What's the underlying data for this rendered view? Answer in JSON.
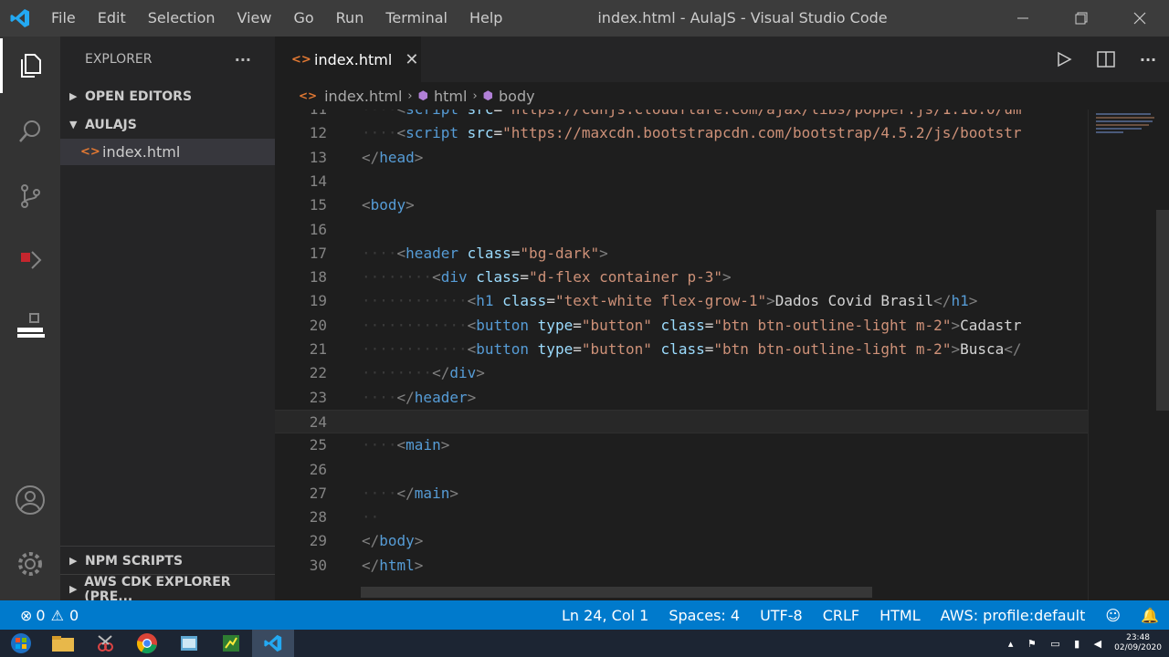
{
  "window": {
    "title": "index.html - AulaJS - Visual Studio Code"
  },
  "menu": [
    "File",
    "Edit",
    "Selection",
    "View",
    "Go",
    "Run",
    "Terminal",
    "Help"
  ],
  "sidebar": {
    "header": "EXPLORER",
    "more": "···",
    "open_editors": "OPEN EDITORS",
    "project": "AULAJS",
    "file": "index.html",
    "npm_scripts": "NPM SCRIPTS",
    "aws": "AWS CDK EXPLORER (PRE..."
  },
  "tab": {
    "label": "index.html",
    "close": "✕"
  },
  "breadcrumb": {
    "file": "index.html",
    "html": "html",
    "body": "body"
  },
  "code": {
    "lines": [
      {
        "n": "11",
        "tokens": [
          [
            "w",
            "····"
          ],
          [
            "p",
            "<"
          ],
          [
            "t",
            "script"
          ],
          [
            "x2",
            " "
          ],
          [
            "a",
            "src"
          ],
          [
            "x2",
            "="
          ],
          [
            "s",
            "\"https://cdnjs.cloudflare.com/ajax/libs/popper.js/1.16.0/um"
          ]
        ]
      },
      {
        "n": "12",
        "tokens": [
          [
            "w",
            "····"
          ],
          [
            "p",
            "<"
          ],
          [
            "t",
            "script"
          ],
          [
            "x2",
            " "
          ],
          [
            "a",
            "src"
          ],
          [
            "x2",
            "="
          ],
          [
            "s",
            "\"https://maxcdn.bootstrapcdn.com/bootstrap/4.5.2/js/bootstr"
          ]
        ]
      },
      {
        "n": "13",
        "tokens": [
          [
            "p",
            "</"
          ],
          [
            "t",
            "head"
          ],
          [
            "p",
            ">"
          ]
        ]
      },
      {
        "n": "14",
        "tokens": []
      },
      {
        "n": "15",
        "tokens": [
          [
            "p",
            "<"
          ],
          [
            "t",
            "body"
          ],
          [
            "p",
            ">"
          ]
        ]
      },
      {
        "n": "16",
        "tokens": []
      },
      {
        "n": "17",
        "tokens": [
          [
            "w",
            "····"
          ],
          [
            "p",
            "<"
          ],
          [
            "t",
            "header"
          ],
          [
            "x2",
            " "
          ],
          [
            "a",
            "class"
          ],
          [
            "x2",
            "="
          ],
          [
            "s",
            "\"bg-dark\""
          ],
          [
            "p",
            ">"
          ]
        ]
      },
      {
        "n": "18",
        "tokens": [
          [
            "w",
            "········"
          ],
          [
            "p",
            "<"
          ],
          [
            "t",
            "div"
          ],
          [
            "x2",
            " "
          ],
          [
            "a",
            "class"
          ],
          [
            "x2",
            "="
          ],
          [
            "s",
            "\"d-flex container p-3\""
          ],
          [
            "p",
            ">"
          ]
        ]
      },
      {
        "n": "19",
        "tokens": [
          [
            "w",
            "············"
          ],
          [
            "p",
            "<"
          ],
          [
            "t",
            "h1"
          ],
          [
            "x2",
            " "
          ],
          [
            "a",
            "class"
          ],
          [
            "x2",
            "="
          ],
          [
            "s",
            "\"text-white flex-grow-1\""
          ],
          [
            "p",
            ">"
          ],
          [
            "x2",
            "Dados Covid Brasil"
          ],
          [
            "p",
            "</"
          ],
          [
            "t",
            "h1"
          ],
          [
            "p",
            ">"
          ]
        ]
      },
      {
        "n": "20",
        "tokens": [
          [
            "w",
            "············"
          ],
          [
            "p",
            "<"
          ],
          [
            "t",
            "button"
          ],
          [
            "x2",
            " "
          ],
          [
            "a",
            "type"
          ],
          [
            "x2",
            "="
          ],
          [
            "s",
            "\"button\""
          ],
          [
            "x2",
            " "
          ],
          [
            "a",
            "class"
          ],
          [
            "x2",
            "="
          ],
          [
            "s",
            "\"btn btn-outline-light m-2\""
          ],
          [
            "p",
            ">"
          ],
          [
            "x2",
            "Cadastr"
          ]
        ]
      },
      {
        "n": "21",
        "tokens": [
          [
            "w",
            "············"
          ],
          [
            "p",
            "<"
          ],
          [
            "t",
            "button"
          ],
          [
            "x2",
            " "
          ],
          [
            "a",
            "type"
          ],
          [
            "x2",
            "="
          ],
          [
            "s",
            "\"button\""
          ],
          [
            "x2",
            " "
          ],
          [
            "a",
            "class"
          ],
          [
            "x2",
            "="
          ],
          [
            "s",
            "\"btn btn-outline-light m-2\""
          ],
          [
            "p",
            ">"
          ],
          [
            "x2",
            "Busca"
          ],
          [
            "p",
            "</"
          ]
        ]
      },
      {
        "n": "22",
        "tokens": [
          [
            "w",
            "········"
          ],
          [
            "p",
            "</"
          ],
          [
            "t",
            "div"
          ],
          [
            "p",
            ">"
          ]
        ]
      },
      {
        "n": "23",
        "tokens": [
          [
            "w",
            "····"
          ],
          [
            "p",
            "</"
          ],
          [
            "t",
            "header"
          ],
          [
            "p",
            ">"
          ]
        ]
      },
      {
        "n": "24",
        "tokens": []
      },
      {
        "n": "25",
        "tokens": [
          [
            "w",
            "····"
          ],
          [
            "p",
            "<"
          ],
          [
            "t",
            "main"
          ],
          [
            "p",
            ">"
          ]
        ]
      },
      {
        "n": "26",
        "tokens": []
      },
      {
        "n": "27",
        "tokens": [
          [
            "w",
            "····"
          ],
          [
            "p",
            "</"
          ],
          [
            "t",
            "main"
          ],
          [
            "p",
            ">"
          ]
        ]
      },
      {
        "n": "28",
        "tokens": [
          [
            "w",
            "··"
          ]
        ]
      },
      {
        "n": "29",
        "tokens": [
          [
            "p",
            "</"
          ],
          [
            "t",
            "body"
          ],
          [
            "p",
            ">"
          ]
        ]
      },
      {
        "n": "30",
        "tokens": [
          [
            "p",
            "</"
          ],
          [
            "t",
            "html"
          ],
          [
            "p",
            ">"
          ]
        ]
      }
    ]
  },
  "status": {
    "errors": "0",
    "warnings": "0",
    "position": "Ln 24, Col 1",
    "spaces": "Spaces: 4",
    "encoding": "UTF-8",
    "eol": "CRLF",
    "language": "HTML",
    "aws": "AWS: profile:default"
  },
  "tray": {
    "time": "23:48",
    "date": "02/09/2020"
  },
  "colors": {
    "statusbar": "#007acc",
    "titlebar": "#3c3c3c",
    "activitybar": "#333333",
    "sidebar": "#252526",
    "editor": "#1e1e1e"
  }
}
